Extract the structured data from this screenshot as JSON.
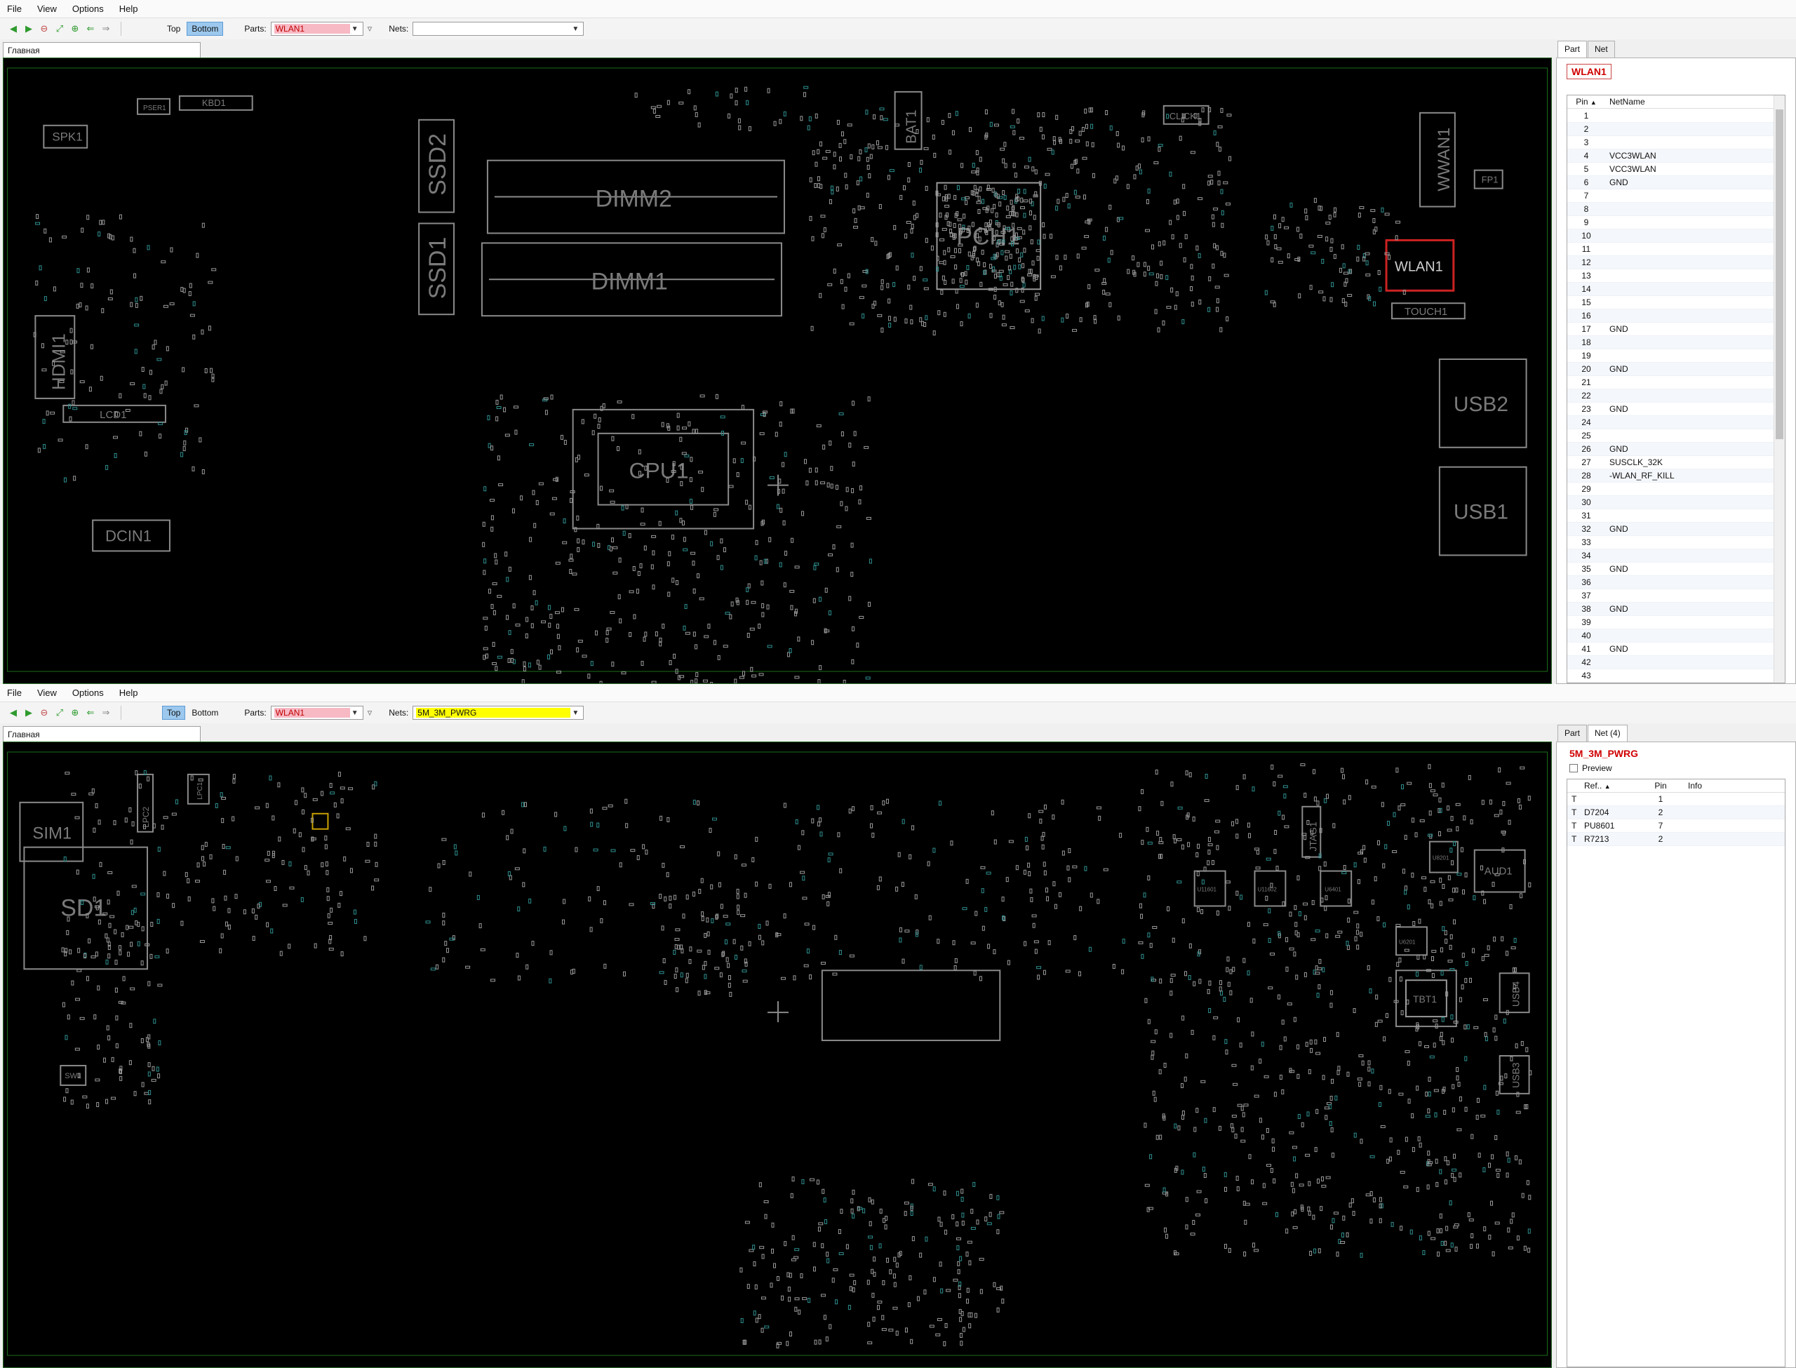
{
  "menu": [
    "File",
    "View",
    "Options",
    "Help"
  ],
  "labels": {
    "top": "Top",
    "bottom": "Bottom",
    "parts": "Parts:",
    "nets": "Nets:"
  },
  "tab_main": "Главная",
  "top_pane": {
    "side_active": "Bottom",
    "parts_value": "WLAN1",
    "nets_value": "",
    "right_tabs": [
      "Part",
      "Net"
    ],
    "active_right_tab": "Part",
    "part_name": "WLAN1",
    "pin_table": {
      "headers": [
        "Pin",
        "NetName"
      ],
      "rows": [
        [
          "1",
          ""
        ],
        [
          "2",
          ""
        ],
        [
          "3",
          ""
        ],
        [
          "4",
          "VCC3WLAN"
        ],
        [
          "5",
          "VCC3WLAN"
        ],
        [
          "6",
          "GND"
        ],
        [
          "7",
          ""
        ],
        [
          "8",
          ""
        ],
        [
          "9",
          ""
        ],
        [
          "10",
          ""
        ],
        [
          "11",
          ""
        ],
        [
          "12",
          ""
        ],
        [
          "13",
          ""
        ],
        [
          "14",
          ""
        ],
        [
          "15",
          ""
        ],
        [
          "16",
          ""
        ],
        [
          "17",
          "GND"
        ],
        [
          "18",
          ""
        ],
        [
          "19",
          ""
        ],
        [
          "20",
          "GND"
        ],
        [
          "21",
          ""
        ],
        [
          "22",
          ""
        ],
        [
          "23",
          "GND"
        ],
        [
          "24",
          ""
        ],
        [
          "25",
          ""
        ],
        [
          "26",
          "GND"
        ],
        [
          "27",
          "SUSCLK_32K"
        ],
        [
          "28",
          "-WLAN_RF_KILL"
        ],
        [
          "29",
          ""
        ],
        [
          "30",
          ""
        ],
        [
          "31",
          ""
        ],
        [
          "32",
          "GND"
        ],
        [
          "33",
          ""
        ],
        [
          "34",
          ""
        ],
        [
          "35",
          "GND"
        ],
        [
          "36",
          ""
        ],
        [
          "37",
          ""
        ],
        [
          "38",
          "GND"
        ],
        [
          "39",
          ""
        ],
        [
          "40",
          ""
        ],
        [
          "41",
          "GND"
        ],
        [
          "42",
          ""
        ],
        [
          "43",
          ""
        ]
      ]
    },
    "board_labels": [
      "SPK1",
      "KBD1",
      "PSER1",
      "SSD2",
      "SSD1",
      "DIMM2",
      "DIMM1",
      "BAT1",
      "CLICK1",
      "PCH1",
      "WWAN1",
      "FP1",
      "WLAN1",
      "TOUCH1",
      "HDMI1",
      "LCD1",
      "USB2",
      "USB1",
      "CPU1",
      "DCIN1"
    ]
  },
  "bottom_pane": {
    "side_active": "Top",
    "parts_value": "WLAN1",
    "nets_value": "5M_3M_PWRG",
    "right_tabs": [
      "Part",
      "Net (4)"
    ],
    "active_right_tab": "Net (4)",
    "net_name": "5M_3M_PWRG",
    "preview_label": "Preview",
    "net_table": {
      "headers": [
        "",
        "Ref..",
        "Pin",
        "Info"
      ],
      "rows": [
        [
          "T",
          "",
          "1",
          ""
        ],
        [
          "T",
          "D7204",
          "2",
          ""
        ],
        [
          "T",
          "PU8601",
          "7",
          ""
        ],
        [
          "T",
          "R7213",
          "2",
          ""
        ]
      ]
    },
    "board_labels": [
      "SIM1",
      "SD1",
      "SW1",
      "AUD1",
      "TBT1",
      "USB4",
      "USB3",
      "JTAG1",
      "LPC2",
      "LPC1",
      "U11601",
      "U11602",
      "U6401",
      "U6201",
      "U8201"
    ]
  },
  "colors": {
    "board_bg": "#000000",
    "outline": "#8a8a8a",
    "selection": "#cc2222",
    "highlight_pink": "#f7b9c4",
    "highlight_yellow": "#ffff00",
    "accent_blue": "#9cc8ee"
  },
  "icons": [
    "back-icon",
    "forward-icon",
    "zoom-out-icon",
    "zoom-fit-icon",
    "zoom-in-icon",
    "rotate-left-icon",
    "rotate-right-icon",
    "filter-icon",
    "dropdown-arrow-icon",
    "sort-asc-icon"
  ]
}
